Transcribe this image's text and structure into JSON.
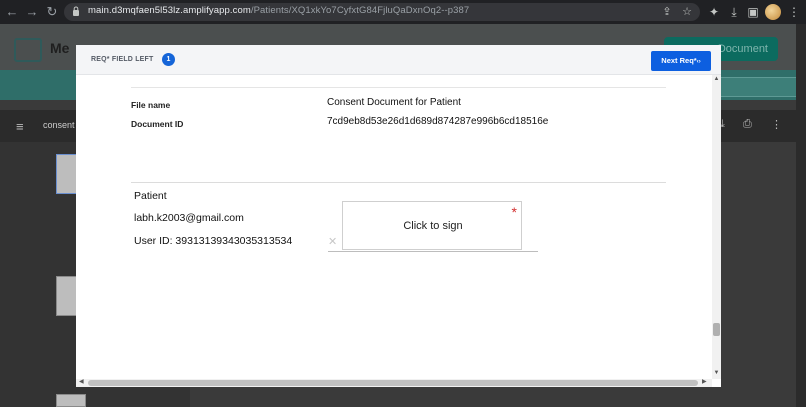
{
  "browser": {
    "url_host": "main.d3mqfaen5l53lz.amplifyapp.com",
    "url_path": "/Patients/XQ1xkYo7CyfxtG84FjluQaDxnOq2--p387",
    "icons": [
      "back-icon",
      "forward-icon",
      "reload-icon",
      "share-icon",
      "star-icon",
      "extensions-icon",
      "download-icon",
      "sidebar-icon",
      "menu-icon"
    ]
  },
  "app": {
    "title": "Me",
    "cta_label": "Document",
    "viewer_tab": "consent"
  },
  "modal": {
    "req_label": "REQ* FIELD LEFT",
    "req_count": "1",
    "next_label": "Next Req*",
    "file_name_label": "File name",
    "file_name_value": "Consent Document for Patient",
    "doc_id_label": "Document ID",
    "doc_id_value": "7cd9eb8d53e26d1d689d874287e996b6cd18516e",
    "patient_label": "Patient",
    "patient_email": "labh.k2003@gmail.com",
    "patient_user_id": "User ID: 39313139343035313534",
    "sign_label": "Click to sign",
    "required_mark": "*"
  }
}
